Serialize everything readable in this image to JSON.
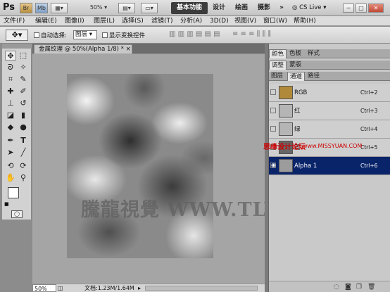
{
  "app_bar": {
    "logo": "Ps",
    "bridge": "Br",
    "mini": "Mb",
    "zoom": "50%",
    "workspaces": [
      "基本功能",
      "设计",
      "绘画",
      "摄影"
    ],
    "more": "»",
    "cslive": "CS Live",
    "win_min": "─",
    "win_max": "□",
    "win_close": "✕"
  },
  "menus": [
    "文件(F)",
    "编辑(E)",
    "图像(I)",
    "图层(L)",
    "选择(S)",
    "滤镜(T)",
    "分析(A)",
    "3D(D)",
    "视图(V)",
    "窗口(W)",
    "帮助(H)"
  ],
  "options": {
    "auto_select": "自动选择:",
    "layer_select": "图层",
    "show_transform": "显示变换控件"
  },
  "document": {
    "tab_title": "金属纹理 @ 50%(Alpha 1/8) *",
    "close": "×",
    "zoom": "50%",
    "doc_info": "文档:1.23M/1.64M"
  },
  "watermark": "騰龍視覺 WWW.TLVI.NET",
  "panels": {
    "top_tabs": [
      "颜色",
      "色板",
      "样式"
    ],
    "mid_tabs": [
      "调整",
      "蒙版"
    ],
    "bottom_tabs": [
      "图层",
      "通道",
      "路径"
    ],
    "channels": [
      {
        "name": "RGB",
        "shortcut": "Ctrl+2",
        "color": "#b08a3a",
        "eye": false,
        "selected": false
      },
      {
        "name": "红",
        "shortcut": "Ctrl+3",
        "color": "#b5b5b5",
        "eye": false,
        "selected": false
      },
      {
        "name": "绿",
        "shortcut": "Ctrl+4",
        "color": "#b5b5b5",
        "eye": false,
        "selected": false
      },
      {
        "name": "蓝",
        "shortcut": "Ctrl+5",
        "color": "#666666",
        "eye": false,
        "selected": false
      },
      {
        "name": "Alpha 1",
        "shortcut": "Ctrl+6",
        "color": "#9c9c9c",
        "eye": true,
        "selected": true
      }
    ]
  },
  "site_credit": {
    "cn": "思缘设计论坛",
    "url": "www.MISSYUAN.COM"
  },
  "colors": {
    "selection": "#0a246a",
    "panel_bg": "#c9c9c9",
    "canvas_bg": "#a5a5a5"
  }
}
